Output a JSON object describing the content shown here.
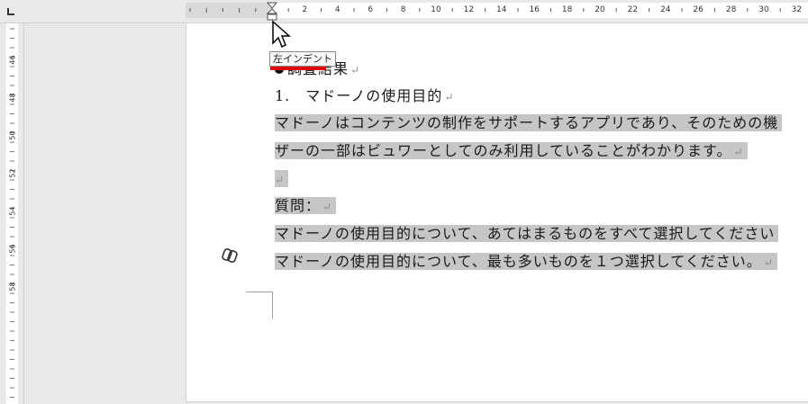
{
  "ruler": {
    "h_labels": [
      "2",
      "4",
      "6",
      "8",
      "10",
      "12",
      "14",
      "16",
      "18",
      "20",
      "22",
      "24",
      "26",
      "28",
      "30",
      "32"
    ],
    "v_labels": [
      "46",
      "48",
      "50",
      "52",
      "54",
      "56",
      "58"
    ]
  },
  "tooltip": {
    "text": "左インデント"
  },
  "document": {
    "heading": "調査結果",
    "section": "1.　マドーノの使用目的",
    "para_line1": "マドーノはコンテンツの制作をサポートするアプリであり、そのための機",
    "para_line2": "ザーの一部はビュワーとしてのみ利用していることがわかります。",
    "question_label": "質問：",
    "question_line1": "マドーノの使用目的について、あてはまるものをすべて選択してください",
    "question_line2": "マドーノの使用目的について、最も多いものを１つ選択してください。",
    "paragraph_mark": "↵"
  },
  "colors": {
    "selection": "#c6c6c6",
    "indicator": "#e00000"
  }
}
